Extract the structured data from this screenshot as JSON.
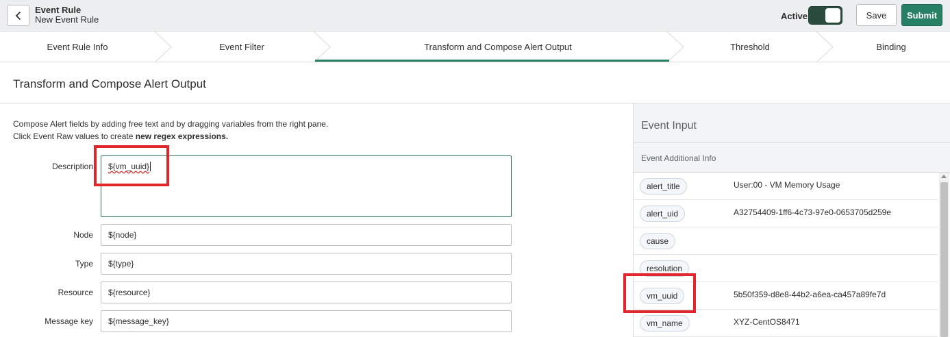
{
  "header": {
    "title": "Event Rule",
    "subtitle": "New Event Rule",
    "active_label": "Active",
    "active": true,
    "save_label": "Save",
    "submit_label": "Submit",
    "accent_color": "#278063"
  },
  "steps": [
    {
      "label": "Event Rule Info"
    },
    {
      "label": "Event Filter"
    },
    {
      "label": "Transform and Compose Alert Output",
      "active": true
    },
    {
      "label": "Threshold"
    },
    {
      "label": "Binding"
    }
  ],
  "section": {
    "title": "Transform and Compose Alert Output",
    "intro_line1": "Compose Alert fields by adding free text and by dragging variables from the right pane.",
    "intro_line2_prefix": "Click Event Raw values to create ",
    "intro_line2_bold": "new regex expressions."
  },
  "form": {
    "fields": [
      {
        "label": "Description",
        "value": "${vm_uuid}"
      },
      {
        "label": "Node",
        "value": "${node}"
      },
      {
        "label": "Type",
        "value": "${type}"
      },
      {
        "label": "Resource",
        "value": "${resource}"
      },
      {
        "label": "Message key",
        "value": "${message_key}"
      }
    ]
  },
  "event_input": {
    "title": "Event Input",
    "subtitle": "Event Additional Info",
    "rows": [
      {
        "key": "alert_title",
        "value": "User:00 - VM Memory Usage"
      },
      {
        "key": "alert_uid",
        "value": "A32754409-1ff6-4c73-97e0-0653705d259e"
      },
      {
        "key": "cause",
        "value": ""
      },
      {
        "key": "resolution",
        "value": ""
      },
      {
        "key": "vm_uuid",
        "value": "5b50f359-d8e8-44b2-a6ea-ca457a89fe7d"
      },
      {
        "key": "vm_name",
        "value": "XYZ-CentOS8471"
      }
    ]
  }
}
